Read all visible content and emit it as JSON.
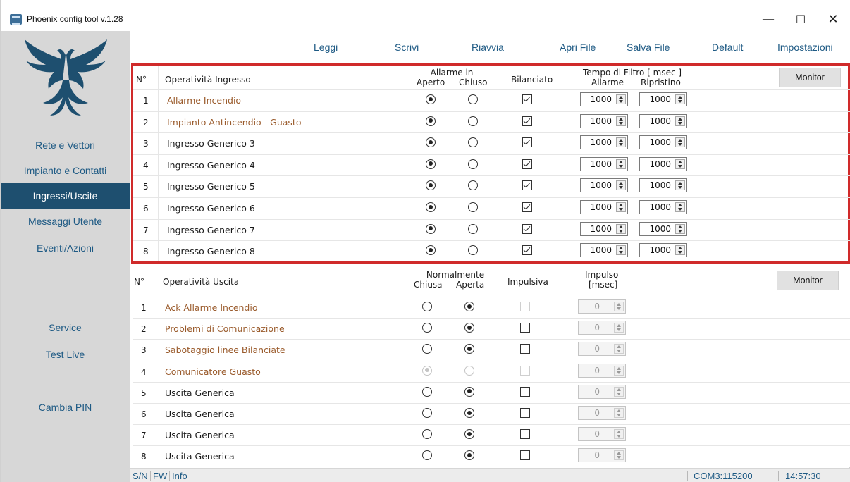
{
  "window": {
    "title": "Phoenix config tool v.1.28",
    "minimize": "—",
    "maximize": "☐",
    "close": "✕"
  },
  "colors": {
    "accent": "#1e5a84",
    "active_bg": "#1e4f6f",
    "highlight_border": "#d02a2a",
    "brown_text": "#9a5b2c"
  },
  "sidebar": {
    "logo_icon": "phoenix-bird-icon",
    "items": [
      {
        "label": "Rete e Vettori"
      },
      {
        "label": "Impianto e Contatti"
      },
      {
        "label": "Ingressi/Uscite"
      },
      {
        "label": "Messaggi Utente"
      },
      {
        "label": "Eventi/Azioni"
      },
      {
        "label": "Service"
      },
      {
        "label": "Test Live"
      },
      {
        "label": "Cambia PIN"
      }
    ]
  },
  "menu": {
    "items": [
      {
        "label": "Leggi"
      },
      {
        "label": "Scrivi"
      },
      {
        "label": "Riavvia"
      },
      {
        "label": "Apri File"
      },
      {
        "label": "Salva File"
      },
      {
        "label": "Default"
      },
      {
        "label": "Impostazioni"
      }
    ]
  },
  "inputs": {
    "headers": {
      "num": "N°",
      "operativita": "Operatività Ingresso",
      "allarme_in": "Allarme in",
      "aperto": "Aperto",
      "chiuso": "Chiuso",
      "bilanciato": "Bilanciato",
      "tempo_filtro": "Tempo di Filtro [ msec ]",
      "allarme": "Allarme",
      "ripristino": "Ripristino",
      "monitor": "Monitor"
    },
    "rows": [
      {
        "num": "1",
        "label": "Allarme Incendio",
        "brown": true,
        "alarm_open": true,
        "balanced": true,
        "filter_alarm": "1000",
        "filter_restore": "1000"
      },
      {
        "num": "2",
        "label": "Impianto Antincendio - Guasto",
        "brown": true,
        "alarm_open": true,
        "balanced": true,
        "filter_alarm": "1000",
        "filter_restore": "1000"
      },
      {
        "num": "3",
        "label": "Ingresso Generico 3",
        "brown": false,
        "alarm_open": true,
        "balanced": true,
        "filter_alarm": "1000",
        "filter_restore": "1000"
      },
      {
        "num": "4",
        "label": "Ingresso Generico 4",
        "brown": false,
        "alarm_open": true,
        "balanced": true,
        "filter_alarm": "1000",
        "filter_restore": "1000"
      },
      {
        "num": "5",
        "label": "Ingresso Generico 5",
        "brown": false,
        "alarm_open": true,
        "balanced": true,
        "filter_alarm": "1000",
        "filter_restore": "1000"
      },
      {
        "num": "6",
        "label": "Ingresso Generico 6",
        "brown": false,
        "alarm_open": true,
        "balanced": true,
        "filter_alarm": "1000",
        "filter_restore": "1000"
      },
      {
        "num": "7",
        "label": "Ingresso Generico 7",
        "brown": false,
        "alarm_open": true,
        "balanced": true,
        "filter_alarm": "1000",
        "filter_restore": "1000"
      },
      {
        "num": "8",
        "label": "Ingresso Generico 8",
        "brown": false,
        "alarm_open": true,
        "balanced": true,
        "filter_alarm": "1000",
        "filter_restore": "1000"
      }
    ]
  },
  "outputs": {
    "headers": {
      "num": "N°",
      "operativita": "Operatività Uscita",
      "normalmente": "Normalmente",
      "chiusa": "Chiusa",
      "aperta": "Aperta",
      "impulsiva": "Impulsiva",
      "impulso": "Impulso",
      "msec": "[msec]",
      "monitor": "Monitor"
    },
    "rows": [
      {
        "num": "1",
        "label": "Ack Allarme Incendio",
        "brown": true,
        "normally_open": true,
        "disabled": false,
        "impulsive_disabled": true,
        "pulse": "0"
      },
      {
        "num": "2",
        "label": "Problemi di Comunicazione",
        "brown": true,
        "normally_open": true,
        "disabled": false,
        "impulsive_disabled": false,
        "pulse": "0"
      },
      {
        "num": "3",
        "label": "Sabotaggio linee Bilanciate",
        "brown": true,
        "normally_open": true,
        "disabled": false,
        "impulsive_disabled": false,
        "pulse": "0"
      },
      {
        "num": "4",
        "label": "Comunicatore Guasto",
        "brown": true,
        "normally_open": false,
        "disabled": true,
        "impulsive_disabled": true,
        "pulse": "0"
      },
      {
        "num": "5",
        "label": "Uscita Generica",
        "brown": false,
        "normally_open": true,
        "disabled": false,
        "impulsive_disabled": false,
        "pulse": "0"
      },
      {
        "num": "6",
        "label": "Uscita Generica",
        "brown": false,
        "normally_open": true,
        "disabled": false,
        "impulsive_disabled": false,
        "pulse": "0"
      },
      {
        "num": "7",
        "label": "Uscita Generica",
        "brown": false,
        "normally_open": true,
        "disabled": false,
        "impulsive_disabled": false,
        "pulse": "0"
      },
      {
        "num": "8",
        "label": "Uscita Generica",
        "brown": false,
        "normally_open": true,
        "disabled": false,
        "impulsive_disabled": false,
        "pulse": "0"
      }
    ]
  },
  "status": {
    "sn": "S/N",
    "fw": "FW",
    "info": "Info",
    "port": "COM3:115200",
    "time": "14:57:30"
  }
}
